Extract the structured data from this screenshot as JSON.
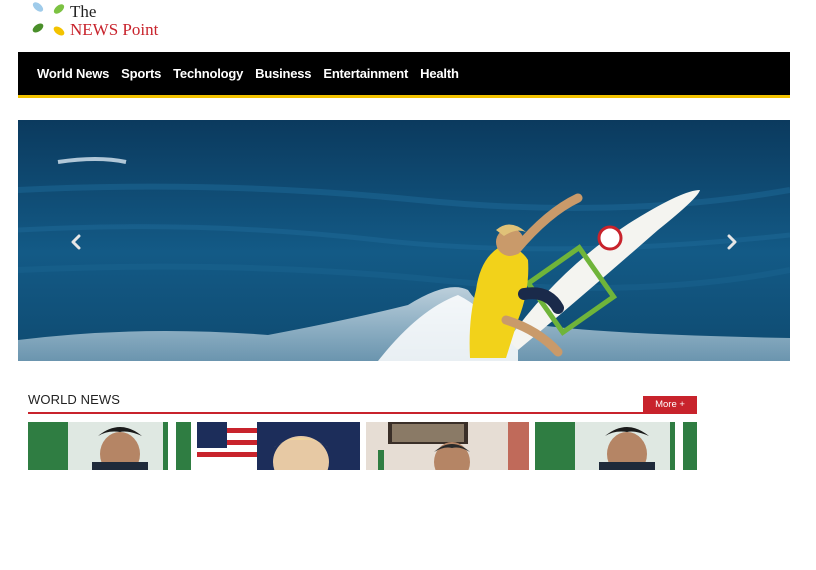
{
  "logo": {
    "line1": "The",
    "line2": "NEWS Point"
  },
  "nav": {
    "items": [
      "World News",
      "Sports",
      "Technology",
      "Business",
      "Entertainment",
      "Health"
    ]
  },
  "section": {
    "title": "WORLD NEWS",
    "more_label": "More +"
  }
}
